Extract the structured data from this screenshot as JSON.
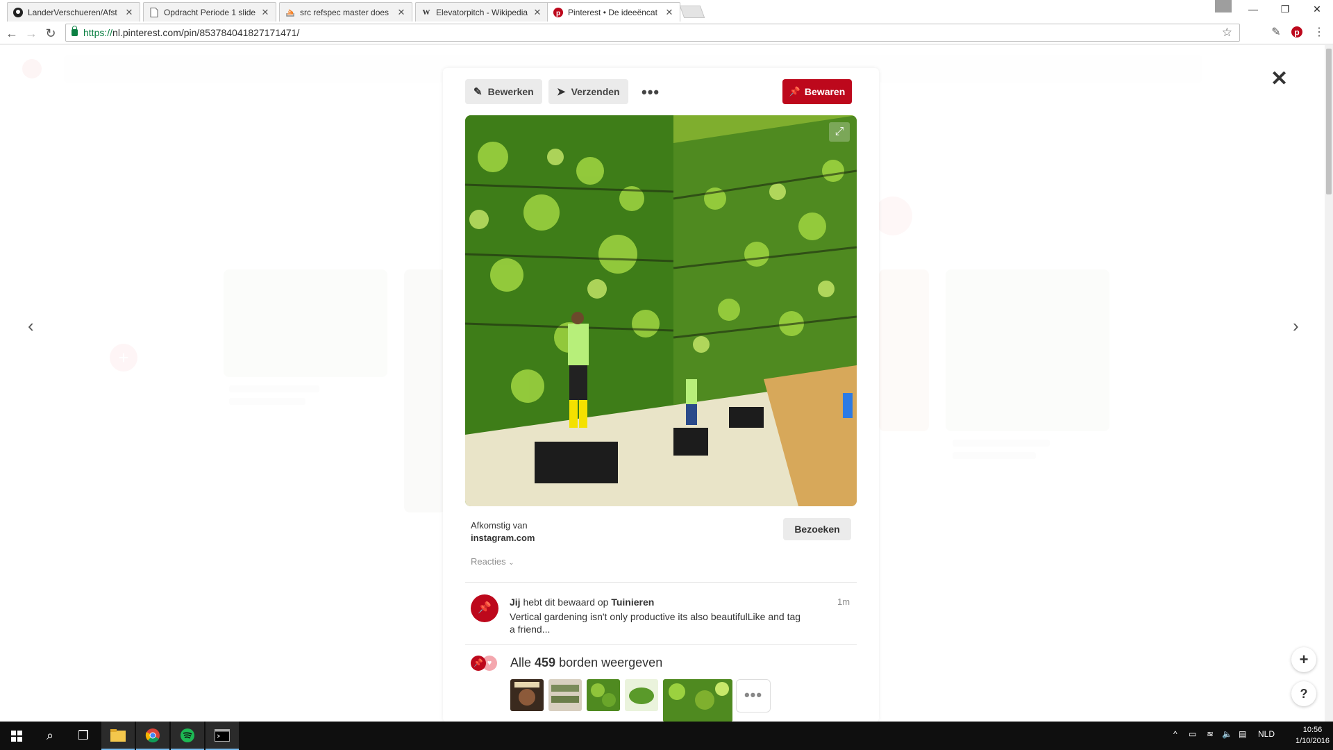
{
  "browser": {
    "tabs": [
      {
        "title": "LanderVerschueren/Afst",
        "favicon": "github-icon",
        "active": false
      },
      {
        "title": "Opdracht Periode 1 slide",
        "favicon": "document-icon",
        "active": false
      },
      {
        "title": "src refspec master does",
        "favicon": "stackoverflow-icon",
        "active": false
      },
      {
        "title": "Elevatorpitch - Wikipedia",
        "favicon": "wikipedia-icon",
        "active": false
      },
      {
        "title": "Pinterest • De ideeëncat",
        "favicon": "pinterest-icon",
        "active": true
      }
    ],
    "url_scheme": "https://",
    "url_rest": "nl.pinterest.com/pin/853784041827171471/"
  },
  "pin": {
    "actions": {
      "edit_label": "Bewerken",
      "send_label": "Verzenden",
      "more_label": "•••",
      "save_label": "Bewaren"
    },
    "source_label": "Afkomstig van",
    "source_domain": "instagram.com",
    "visit_label": "Bezoeken",
    "reactions_label": "Reacties",
    "activity": {
      "actor": "Jij",
      "text": "hebt dit bewaard op",
      "board": "Tuinieren",
      "time": "1m",
      "description": "Vertical gardening isn't only productive its also beautifulLike and tag a friend..."
    },
    "boards": {
      "prefix": "Alle",
      "count": "459",
      "suffix": "borden weergeven",
      "more_label": "•••"
    }
  },
  "fab": {
    "add_label": "+",
    "help_label": "?"
  },
  "taskbar": {
    "language": "NLD",
    "time": "10:56",
    "date": "1/10/2016"
  },
  "colors": {
    "pinterest_red": "#bd081c",
    "taskbar": "#0f0f0f",
    "url_green": "#0b8043"
  }
}
